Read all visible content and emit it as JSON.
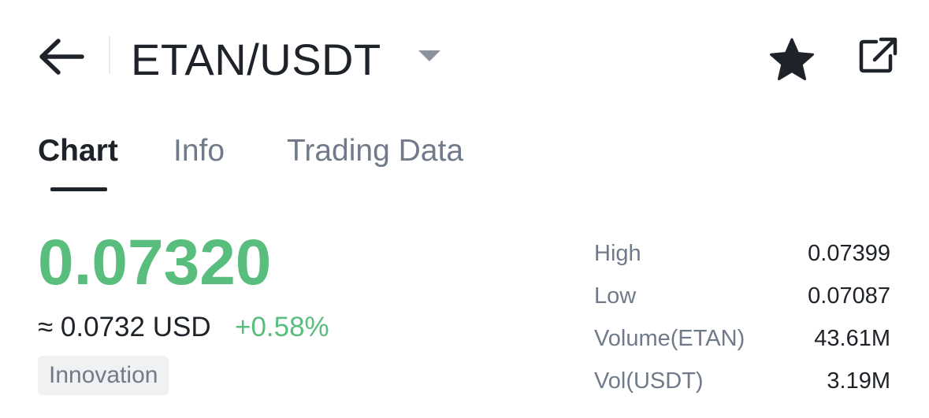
{
  "header": {
    "pair": "ETAN/USDT",
    "icons": [
      "back-arrow-icon",
      "caret-down-icon",
      "star-icon",
      "external-link-icon"
    ]
  },
  "tabs": [
    {
      "label": "Chart",
      "active": true
    },
    {
      "label": "Info",
      "active": false
    },
    {
      "label": "Trading Data",
      "active": false
    }
  ],
  "price": {
    "last": "0.07320",
    "approx": "≈ 0.0732 USD",
    "change": "+0.58%",
    "tag": "Innovation"
  },
  "stats": [
    {
      "label": "High",
      "value": "0.07399"
    },
    {
      "label": "Low",
      "value": "0.07087"
    },
    {
      "label": "Volume(ETAN)",
      "value": "43.61M"
    },
    {
      "label": "Vol(USDT)",
      "value": "3.19M"
    }
  ],
  "colors": {
    "up": "#58bd7d",
    "text": "#1e2329",
    "muted": "#707a8a",
    "caret": "#8c939e",
    "tag_bg": "#f0f1f2"
  }
}
